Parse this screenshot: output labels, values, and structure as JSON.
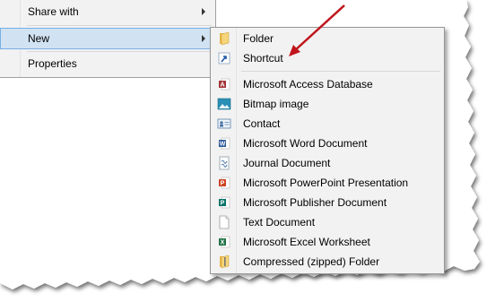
{
  "parent_menu": {
    "items": [
      {
        "label": "Share with",
        "has_submenu": true
      },
      {
        "label": "New",
        "has_submenu": true,
        "highlighted": true
      },
      {
        "label": "Properties",
        "has_submenu": false
      }
    ]
  },
  "new_submenu": {
    "items": [
      {
        "label": "Folder",
        "icon": "folder-icon"
      },
      {
        "label": "Shortcut",
        "icon": "shortcut-icon"
      },
      {
        "label": "Microsoft Access Database",
        "icon": "access-icon"
      },
      {
        "label": "Bitmap image",
        "icon": "bitmap-icon"
      },
      {
        "label": "Contact",
        "icon": "contact-icon"
      },
      {
        "label": "Microsoft Word Document",
        "icon": "word-icon"
      },
      {
        "label": "Journal Document",
        "icon": "journal-icon"
      },
      {
        "label": "Microsoft PowerPoint Presentation",
        "icon": "powerpoint-icon"
      },
      {
        "label": "Microsoft Publisher Document",
        "icon": "publisher-icon"
      },
      {
        "label": "Text Document",
        "icon": "text-document-icon"
      },
      {
        "label": "Microsoft Excel Worksheet",
        "icon": "excel-icon"
      },
      {
        "label": "Compressed (zipped) Folder",
        "icon": "zip-folder-icon"
      }
    ]
  },
  "annotation": {
    "color": "#c0141c",
    "points_to": "Shortcut"
  },
  "colors": {
    "highlight_bg": "#d1e2f2",
    "highlight_border": "#78aee5",
    "menu_bg": "#f2f2f2"
  }
}
